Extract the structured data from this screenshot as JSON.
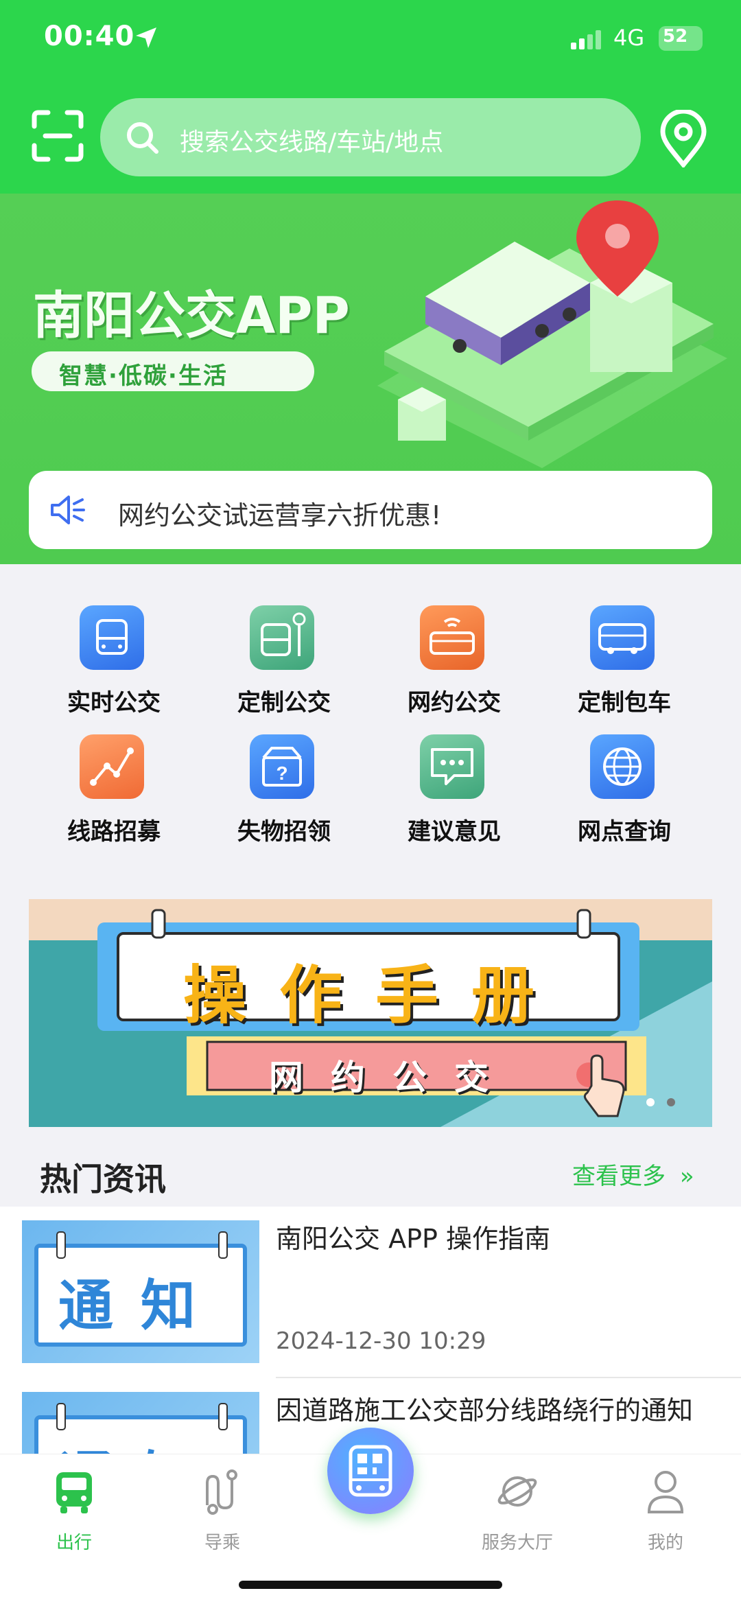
{
  "status_bar": {
    "time": "00:40",
    "network": "4G",
    "battery": "52"
  },
  "search": {
    "placeholder": "搜索公交线路/车站/地点"
  },
  "hero": {
    "title": "南阳公交APP",
    "tagline": "智慧·低碳·生活"
  },
  "notice": {
    "text": "网约公交试运营享六折优惠!"
  },
  "services": [
    {
      "label": "实时公交",
      "icon": "bus-front-icon",
      "color": "#3f8ef5"
    },
    {
      "label": "定制公交",
      "icon": "bus-stop-icon",
      "color": "#4fb88a"
    },
    {
      "label": "网约公交",
      "icon": "bus-wifi-icon",
      "color": "#f07a3c"
    },
    {
      "label": "定制包车",
      "icon": "bus-side-icon",
      "color": "#3f8ef5"
    },
    {
      "label": "线路招募",
      "icon": "route-chart-icon",
      "color": "#f5804a"
    },
    {
      "label": "失物招领",
      "icon": "lost-found-box-icon",
      "color": "#3f8ef5"
    },
    {
      "label": "建议意见",
      "icon": "chat-bubble-icon",
      "color": "#4fb88a"
    },
    {
      "label": "网点查询",
      "icon": "globe-icon",
      "color": "#3f8ef5"
    }
  ],
  "manual_banner": {
    "title": "操作手册",
    "subtitle": "网约公交",
    "slides_total": 2,
    "slide_active": 1
  },
  "news": {
    "title": "热门资讯",
    "more_label": "查看更多",
    "items": [
      {
        "title": "南阳公交 APP 操作指南",
        "date": "2024-12-30 10:29",
        "thumb_text": "通知"
      },
      {
        "title": "因道路施工公交部分线路绕行的通知",
        "date": "",
        "thumb_text": "通知"
      }
    ]
  },
  "tabbar": {
    "items": [
      {
        "label": "出行",
        "icon": "bus-icon",
        "active": true
      },
      {
        "label": "导乘",
        "icon": "route-icon",
        "active": false
      },
      {
        "label": "服务大厅",
        "icon": "planet-icon",
        "active": false
      },
      {
        "label": "我的",
        "icon": "person-icon",
        "active": false
      }
    ],
    "center_icon": "qr-code-bus-icon"
  },
  "colors": {
    "brand_green": "#2cd64c",
    "link_green": "#2cc24c"
  }
}
